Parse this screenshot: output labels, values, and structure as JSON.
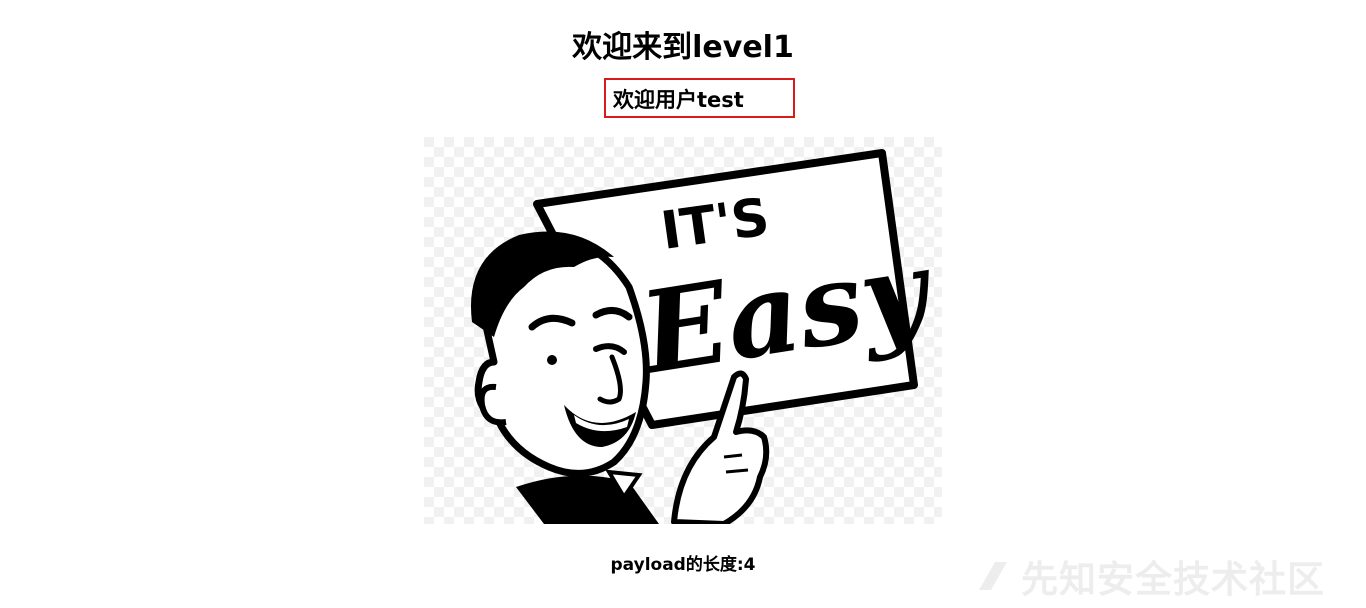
{
  "page": {
    "title": "欢迎来到level1",
    "welcome_user": "欢迎用户test",
    "payload_length": "payload的长度:4"
  },
  "illustration": {
    "sign_line1": "IT'S",
    "sign_line2": "Easy"
  },
  "watermark": {
    "text": "先知安全技术社区"
  },
  "colors": {
    "userbox_border": "#d71c1c"
  }
}
